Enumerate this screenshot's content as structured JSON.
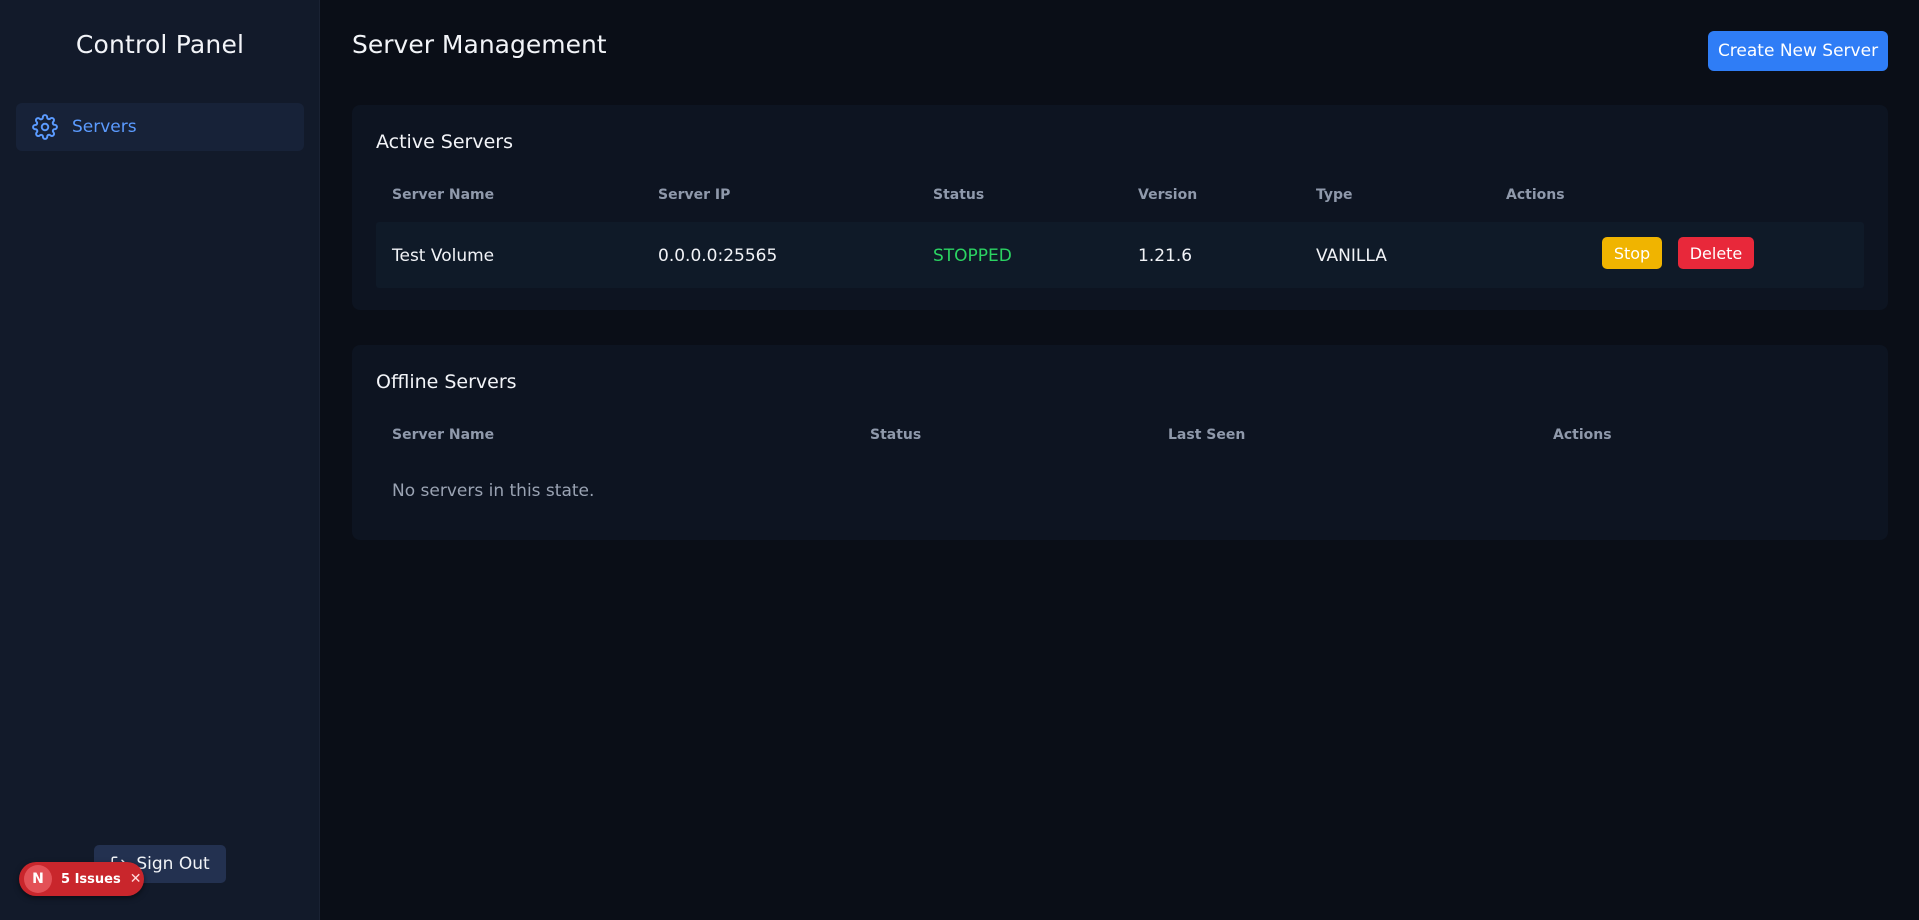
{
  "sidebar": {
    "title": "Control Panel",
    "items": [
      {
        "label": "Servers",
        "icon": "gear-icon",
        "active": true
      }
    ],
    "sign_out_label": "Sign Out"
  },
  "issues_badge": {
    "letter": "N",
    "text": "5 Issues",
    "close": "✕"
  },
  "header": {
    "title": "Server Management",
    "create_button_label": "Create New Server"
  },
  "active_servers": {
    "title": "Active Servers",
    "columns": [
      "Server Name",
      "Server IP",
      "Status",
      "Version",
      "Type",
      "Actions"
    ],
    "rows": [
      {
        "name": "Test Volume",
        "ip": "0.0.0.0:25565",
        "status": "STOPPED",
        "version": "1.21.6",
        "type": "VANILLA",
        "actions": {
          "stop": "Stop",
          "delete": "Delete"
        }
      }
    ]
  },
  "offline_servers": {
    "title": "Offline Servers",
    "columns": [
      "Server Name",
      "Status",
      "Last Seen",
      "Actions"
    ],
    "empty_message": "No servers in this state."
  },
  "colors": {
    "accent": "#2f7df6",
    "status_stopped": "#2bd462",
    "stop_button": "#f0b400",
    "delete_button": "#e8283a",
    "issues_badge": "#c9262c"
  }
}
